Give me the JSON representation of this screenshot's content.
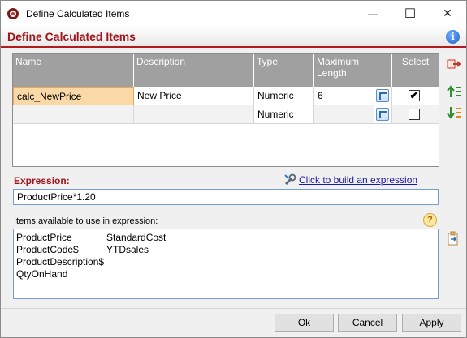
{
  "window": {
    "title": "Define Calculated Items",
    "minimize": "—",
    "maximize": "☐",
    "close": "✕"
  },
  "header": {
    "title": "Define Calculated Items",
    "info_icon": "i"
  },
  "grid": {
    "columns": [
      "Name",
      "Description",
      "Type",
      "Maximum Length",
      "",
      "Select"
    ],
    "rows": [
      {
        "name": "calc_NewPrice",
        "description": "New Price",
        "type": "Numeric",
        "max_length": "6",
        "selected": "✔"
      },
      {
        "name": "",
        "description": "",
        "type": "Numeric",
        "max_length": "",
        "selected": ""
      }
    ]
  },
  "expression": {
    "label": "Expression:",
    "builder_link": "Click to build an expression",
    "value": "ProductPrice*1.20"
  },
  "items": {
    "label": "Items available to use in expression:",
    "help_icon": "?",
    "col1": [
      "ProductPrice",
      "ProductCode$",
      "ProductDescription$",
      "QtyOnHand"
    ],
    "col2": [
      "StandardCost",
      "YTDsales"
    ]
  },
  "buttons": {
    "ok": "Ok",
    "cancel": "Cancel",
    "apply": "Apply"
  }
}
